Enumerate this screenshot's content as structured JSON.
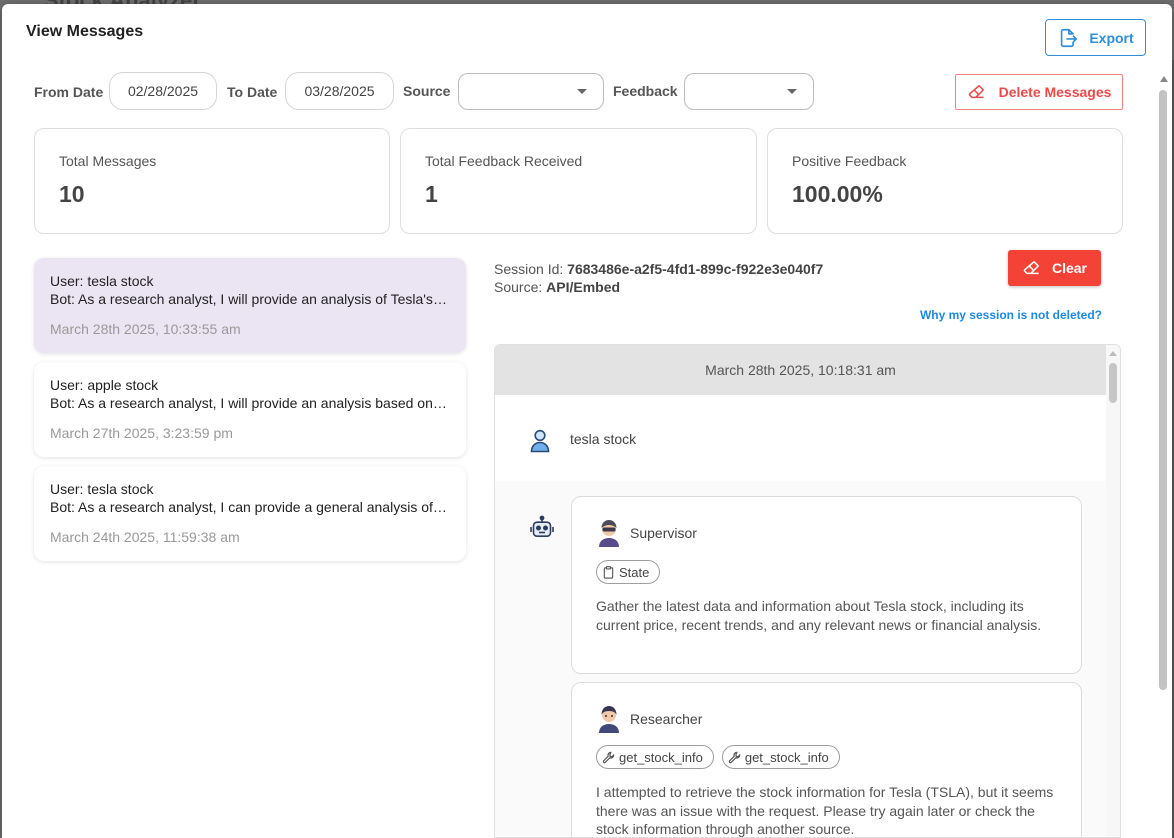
{
  "background": {
    "app_title": "Stock Analyzer"
  },
  "dialog": {
    "title": "View Messages",
    "export_label": "Export"
  },
  "filters": {
    "from_date_label": "From Date",
    "from_date_value": "02/28/2025",
    "to_date_label": "To Date",
    "to_date_value": "03/28/2025",
    "source_label": "Source",
    "source_value": "",
    "feedback_label": "Feedback",
    "feedback_value": "",
    "delete_label": "Delete Messages"
  },
  "stats": [
    {
      "label": "Total Messages",
      "value": "10"
    },
    {
      "label": "Total Feedback Received",
      "value": "1"
    },
    {
      "label": "Positive Feedback",
      "value": "100.00%"
    }
  ],
  "sessions": [
    {
      "user": "User: tesla stock",
      "bot": "Bot: As a research analyst, I will provide an analysis of Tesla's stock",
      "date": "March 28th 2025, 10:33:55 am",
      "selected": true
    },
    {
      "user": "User: apple stock",
      "bot": "Bot: As a research analyst, I will provide an analysis based on general",
      "date": "March 27th 2025, 3:23:59 pm",
      "selected": false
    },
    {
      "user": "User: tesla stock",
      "bot": "Bot: As a research analyst, I can provide a general analysis of Tesla",
      "date": "March 24th 2025, 11:59:38 am",
      "selected": false
    }
  ],
  "session_detail": {
    "session_id_label": "Session Id:",
    "session_id": "7683486e-a2f5-4fd1-899c-f922e3e040f7",
    "source_label": "Source:",
    "source": "API/Embed",
    "clear_label": "Clear",
    "why_link": "Why my session is not deleted?"
  },
  "chat": {
    "date": "March 28th 2025, 10:18:31 am",
    "user_message": "tesla stock",
    "agents": [
      {
        "name": "Supervisor",
        "chips": [
          "State"
        ],
        "text": "Gather the latest data and information about Tesla stock, including its current price, recent trends, and any relevant news or financial analysis."
      },
      {
        "name": "Researcher",
        "chips": [
          "get_stock_info",
          "get_stock_info"
        ],
        "text": "I attempted to retrieve the stock information for Tesla (TSLA), but it seems there was an issue with the request. Please try again later or check the stock information through another source."
      }
    ]
  },
  "colors": {
    "accent_blue": "#2f8fd8",
    "danger_red": "#f44336",
    "selected_bg": "#ebe5f3",
    "link_blue": "#1e88e5"
  }
}
